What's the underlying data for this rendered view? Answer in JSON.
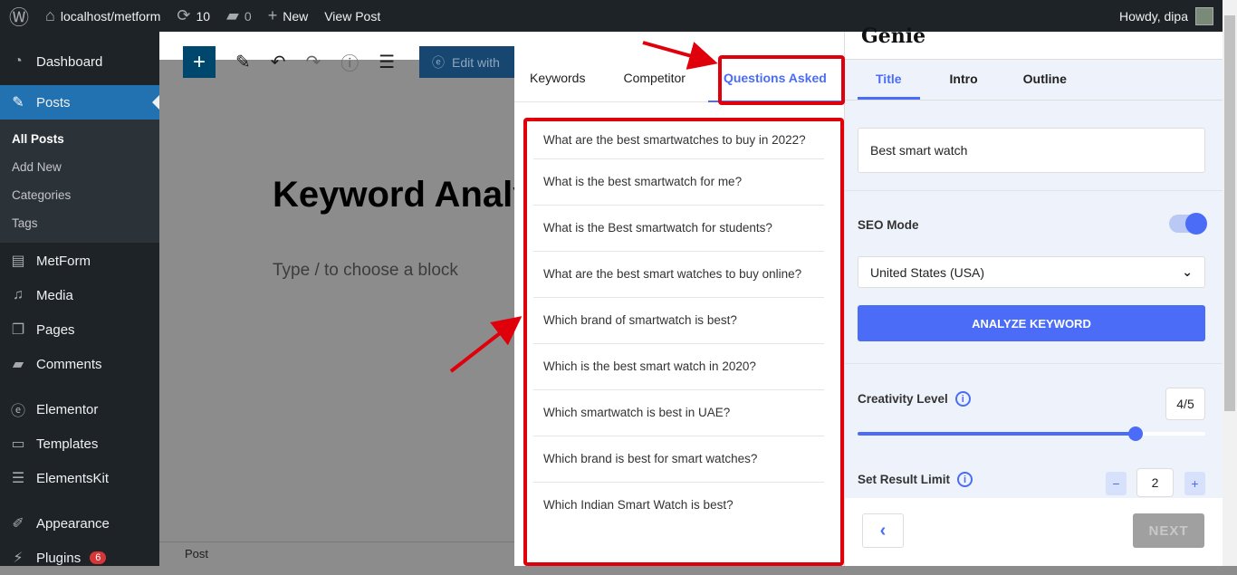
{
  "adminbar": {
    "site": "localhost/metform",
    "updates": "10",
    "comments": "0",
    "new": "New",
    "view_post": "View Post",
    "howdy": "Howdy, dipa"
  },
  "sidebar": {
    "items": [
      {
        "label": "Dashboard",
        "icon": "dashboard-icon"
      },
      {
        "label": "Posts",
        "icon": "pin-icon"
      },
      {
        "label": "MetForm",
        "icon": "metform-icon"
      },
      {
        "label": "Media",
        "icon": "media-icon"
      },
      {
        "label": "Pages",
        "icon": "pages-icon"
      },
      {
        "label": "Comments",
        "icon": "comment-icon"
      },
      {
        "label": "Elementor",
        "icon": "elementor-icon"
      },
      {
        "label": "Templates",
        "icon": "folder-icon"
      },
      {
        "label": "ElementsKit",
        "icon": "elementskit-icon"
      },
      {
        "label": "Appearance",
        "icon": "brush-icon"
      },
      {
        "label": "Plugins",
        "icon": "plug-icon",
        "badge": "6"
      }
    ],
    "submenu": [
      "All Posts",
      "Add New",
      "Categories",
      "Tags"
    ]
  },
  "editor": {
    "edit_with": "Edit with",
    "title": "Keyword Analy",
    "placeholder": "Type / to choose a block",
    "footer": "Post"
  },
  "keyword_panel": {
    "tabs": [
      "Keywords",
      "Competitor",
      "Questions Asked"
    ],
    "active_tab": "Questions Asked",
    "questions": [
      "What are the best smartwatches to buy in 2022?",
      "What is the best smartwatch for me?",
      "What is the Best smartwatch for students?",
      "What are the best smart watches to buy online?",
      "Which brand of smartwatch is best?",
      "Which is the best smart watch in 2020?",
      "Which smartwatch is best in UAE?",
      "Which brand is best for smart watches?",
      "Which Indian Smart Watch is best?"
    ]
  },
  "genie": {
    "logo": "Genie",
    "tabs": [
      "Title",
      "Intro",
      "Outline"
    ],
    "active_tab": "Title",
    "keyword": "Best smart watch",
    "seo_mode_label": "SEO Mode",
    "seo_mode": true,
    "country": "United States (USA)",
    "analyze": "ANALYZE KEYWORD",
    "creativity_label": "Creativity Level",
    "creativity_value": "4/5",
    "creativity_fraction": 0.8,
    "result_limit_label": "Set Result Limit",
    "result_limit": "2",
    "next": "NEXT"
  },
  "colors": {
    "accent": "#4a6cf7",
    "highlight": "#e0000b",
    "wp_dark": "#1d2327",
    "wp_blue": "#2271b1"
  }
}
